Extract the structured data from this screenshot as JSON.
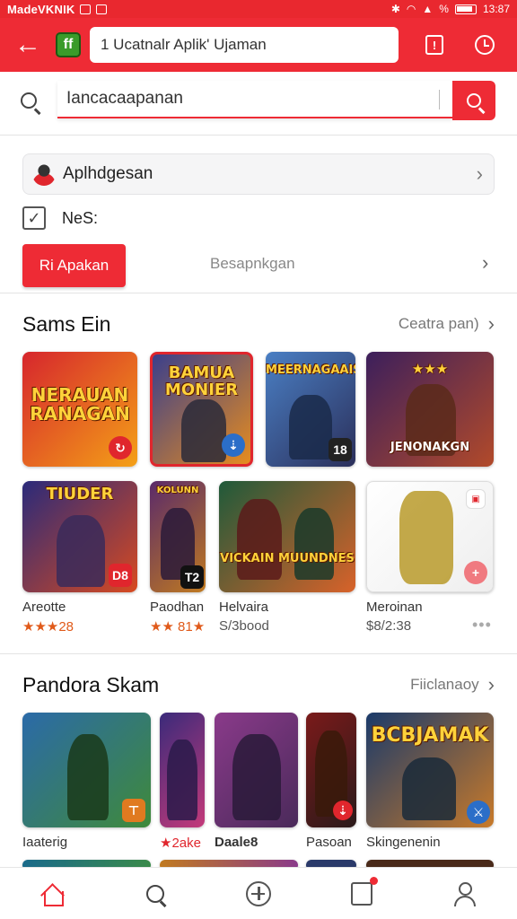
{
  "status_bar": {
    "left_text": "MadeVKNIK",
    "right_text": "% ",
    "time": "13:87"
  },
  "app_bar": {
    "logo_text": "ff",
    "url_text": "1 Ucatnalr Aplik' Ujaman"
  },
  "search": {
    "value": "Iancacaapanan"
  },
  "account": {
    "label": "Aplhdgesan"
  },
  "checkbox": {
    "label": "NeS:"
  },
  "tabs": {
    "active": "Ri Apakan",
    "inactive": "Besapnkgan"
  },
  "section1": {
    "title": "Sams Ein",
    "more": "Ceatra pan)",
    "row1": [
      {
        "title": "NERAUAN RANAGAN",
        "colors": [
          "#d6262d",
          "#f4a017"
        ]
      },
      {
        "title": "BAMUA MONIER",
        "colors": [
          "#3a3f8c",
          "#e78c1e"
        ]
      },
      {
        "title": "MEERNAGAAIS",
        "badge": "18",
        "colors": [
          "#4a7fc4",
          "#2b2f5a"
        ]
      },
      {
        "title": "JENONAKGN",
        "colors": [
          "#3c1f5c",
          "#b24a2a"
        ]
      }
    ],
    "row2": [
      {
        "title": "TIUDER",
        "badge": "D8",
        "name": "Areotte",
        "sub": "★★★28",
        "colors": [
          "#2a2a7a",
          "#d84a20"
        ]
      },
      {
        "title": "KOLUNN",
        "badge": "T2",
        "name": "Paodhan",
        "sub": "★★ 81★",
        "colors": [
          "#5a2a6a",
          "#c07a20"
        ]
      },
      {
        "title": "VICKAIN MUUNDNES",
        "name": "Helvaira",
        "sub": "S/3bood",
        "colors": [
          "#1f5a3a",
          "#d8622a"
        ]
      },
      {
        "title": "",
        "name": "Meroinan",
        "sub": "$8/2:38",
        "colors": [
          "#ffffff",
          "#eeeeee"
        ]
      }
    ]
  },
  "section2": {
    "title": "Pandora Skam",
    "more": "Fiiclanaoy",
    "row": [
      {
        "title": "",
        "name": "Iaaterig",
        "colors": [
          "#2b6aa8",
          "#3f8a3a"
        ]
      },
      {
        "title": "",
        "name": "★2ake",
        "colors": [
          "#3a2a7a",
          "#c43a7a"
        ]
      },
      {
        "title": "",
        "name": "Daale8",
        "colors": [
          "#8a3a8a",
          "#4a2a5a"
        ]
      },
      {
        "title": "",
        "name": "Pasoan",
        "colors": [
          "#7a1a1a",
          "#2a1a1a"
        ]
      },
      {
        "title": "BCBJAMAK",
        "name": "Skingenenin",
        "colors": [
          "#1a3a6a",
          "#c87a2a"
        ]
      }
    ]
  },
  "nav": [
    "home",
    "search",
    "add",
    "notifications",
    "profile"
  ]
}
